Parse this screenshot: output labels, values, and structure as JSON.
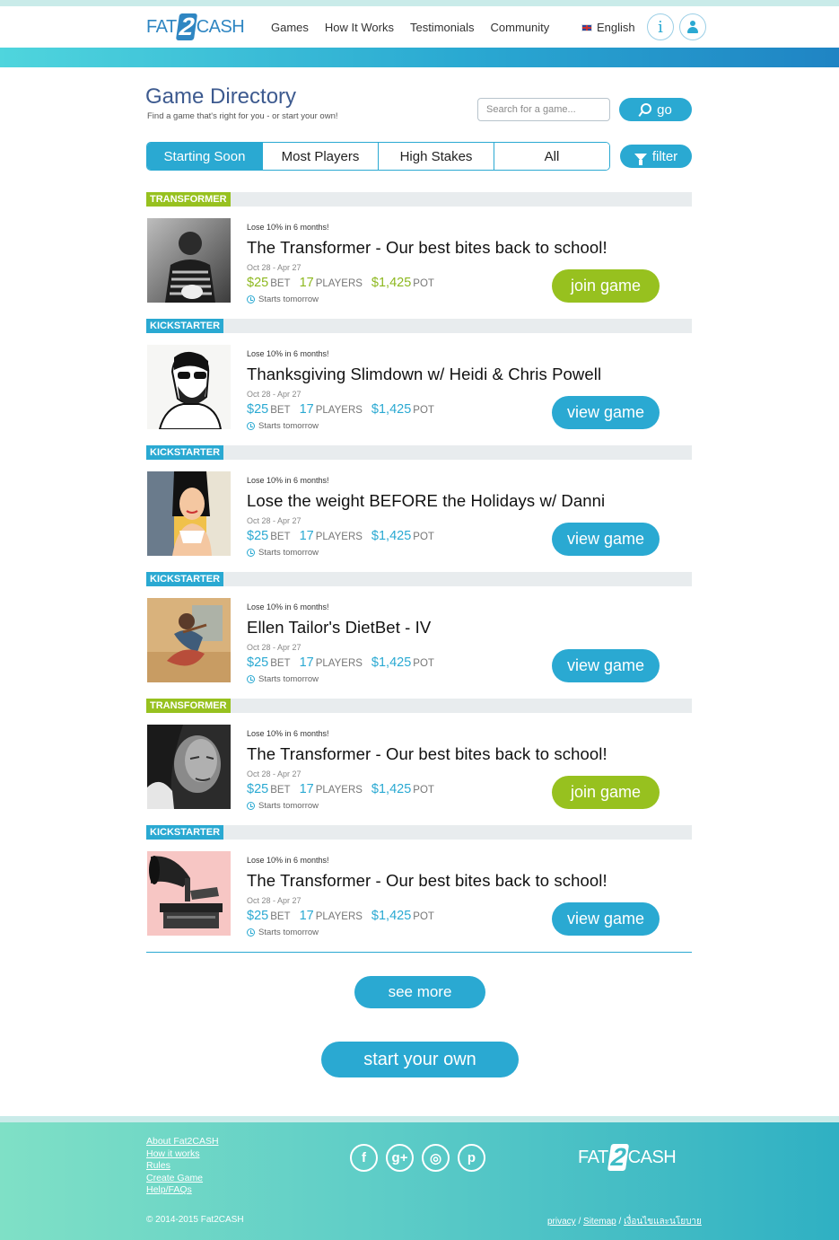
{
  "header": {
    "logo": {
      "part1": "FAT",
      "part2": "2",
      "part3": "CASH"
    },
    "nav": [
      "Games",
      "How It Works",
      "Testimonials",
      "Community"
    ],
    "language": "English",
    "info_label": "i"
  },
  "directory": {
    "title": "Game Directory",
    "subtitle": "Find a game that's right for you - or start your own!",
    "search_placeholder": "Search for a game...",
    "go_label": "go",
    "tabs": [
      "Starting Soon",
      "Most Players",
      "High Stakes",
      "All"
    ],
    "active_tab": "Starting Soon",
    "filter_label": "filter"
  },
  "games": [
    {
      "tag": "TRANSFORMER",
      "goal": "Lose 10% in 6 months!",
      "title": "The Transformer - Our best bites back to school!",
      "dates": "Oct 28 - Apr 27",
      "bet": "$25",
      "bet_label": "BET",
      "players": "17",
      "players_label": "PLAYERS",
      "pot": "$1,425",
      "pot_label": "POT",
      "starts": "Starts tomorrow",
      "action": "join game"
    },
    {
      "tag": "KICKSTARTER",
      "goal": "Lose 10% in 6 months!",
      "title": "Thanksgiving Slimdown w/ Heidi & Chris Powell",
      "dates": "Oct 28 - Apr 27",
      "bet": "$25",
      "bet_label": "BET",
      "players": "17",
      "players_label": "PLAYERS",
      "pot": "$1,425",
      "pot_label": "POT",
      "starts": "Starts tomorrow",
      "action": "view game"
    },
    {
      "tag": "KICKSTARTER",
      "goal": "Lose 10% in 6 months!",
      "title": "Lose the weight BEFORE the Holidays w/ Danni",
      "dates": "Oct 28 - Apr 27",
      "bet": "$25",
      "bet_label": "BET",
      "players": "17",
      "players_label": "PLAYERS",
      "pot": "$1,425",
      "pot_label": "POT",
      "starts": "Starts tomorrow",
      "action": "view game"
    },
    {
      "tag": "KICKSTARTER",
      "goal": "Lose 10% in 6 months!",
      "title": "Ellen Tailor's DietBet - IV",
      "dates": "Oct 28 - Apr 27",
      "bet": "$25",
      "bet_label": "BET",
      "players": "17",
      "players_label": "PLAYERS",
      "pot": "$1,425",
      "pot_label": "POT",
      "starts": "Starts tomorrow",
      "action": "view game"
    },
    {
      "tag": "TRANSFORMER",
      "goal": "Lose 10% in 6 months!",
      "title": "The Transformer - Our best bites back to school!",
      "dates": "Oct 28 - Apr 27",
      "bet": "$25",
      "bet_label": "BET",
      "players": "17",
      "players_label": "PLAYERS",
      "pot": "$1,425",
      "pot_label": "POT",
      "starts": "Starts tomorrow",
      "action": "join game"
    },
    {
      "tag": "KICKSTARTER",
      "goal": "Lose 10% in 6 months!",
      "title": "The Transformer - Our best bites back to school!",
      "dates": "Oct 28 - Apr 27",
      "bet": "$25",
      "bet_label": "BET",
      "players": "17",
      "players_label": "PLAYERS",
      "pot": "$1,425",
      "pot_label": "POT",
      "starts": "Starts tomorrow",
      "action": "view game"
    }
  ],
  "actions": {
    "see_more": "see more",
    "start_own": "start your own"
  },
  "footer": {
    "links": [
      "About Fat2CASH",
      "How it works",
      "Rules",
      "Create Game",
      "Help/FAQs"
    ],
    "social": [
      "facebook-icon",
      "google-plus-icon",
      "instagram-icon",
      "pinterest-icon"
    ],
    "social_glyphs": [
      "f",
      "g+",
      "◎",
      "p"
    ],
    "copyright": "© 2014-2015 Fat2CASH",
    "legal": {
      "privacy": "privacy",
      "sep": " / ",
      "sitemap": "Sitemap",
      "thai": "เงื่อนไขและนโยบาย"
    }
  },
  "colors": {
    "accent_blue": "#2aa9d2",
    "accent_green": "#97c11f",
    "title_navy": "#3d5a8f"
  }
}
